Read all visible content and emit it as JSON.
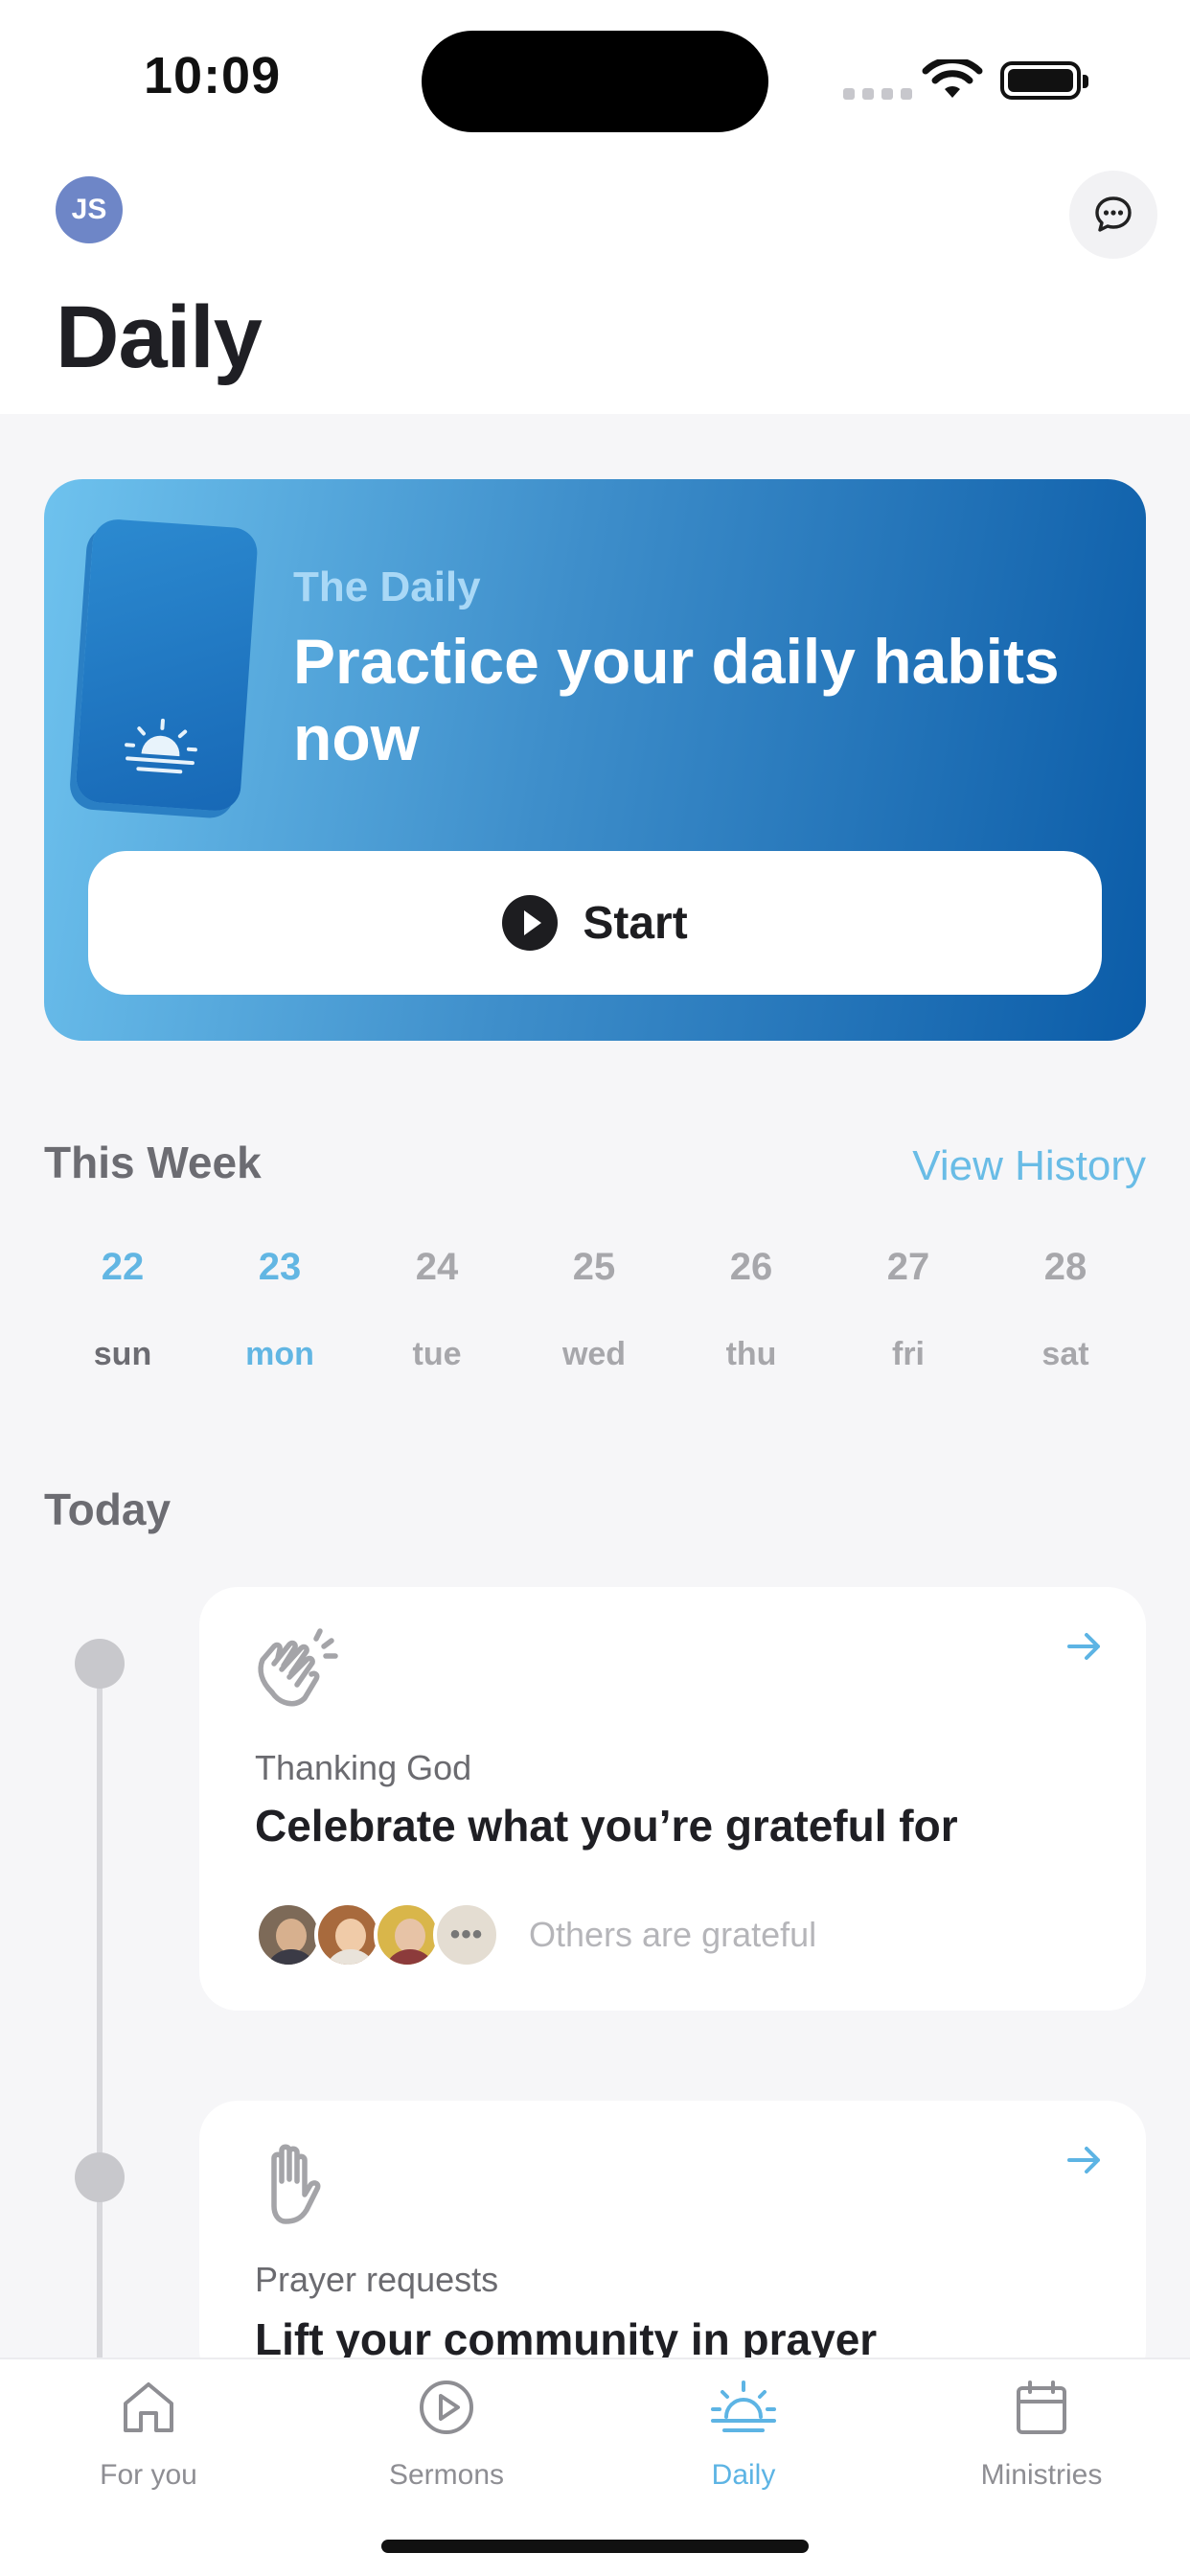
{
  "status_bar": {
    "time": "10:09"
  },
  "header": {
    "avatar_initials": "JS",
    "title": "Daily"
  },
  "hero": {
    "eyebrow": "The Daily",
    "title": "Practice your daily habits now",
    "start_label": "Start",
    "colors": {
      "gradient_start": "#6ec2ee",
      "gradient_end": "#0b5ca8"
    }
  },
  "week": {
    "title": "This Week",
    "view_history": "View History",
    "days": [
      {
        "num": "22",
        "name": "sun"
      },
      {
        "num": "23",
        "name": "mon"
      },
      {
        "num": "24",
        "name": "tue"
      },
      {
        "num": "25",
        "name": "wed"
      },
      {
        "num": "26",
        "name": "thu"
      },
      {
        "num": "27",
        "name": "fri"
      },
      {
        "num": "28",
        "name": "sat"
      }
    ]
  },
  "today": {
    "title": "Today",
    "tasks": [
      {
        "kicker": "Thanking God",
        "title": "Celebrate what you’re grateful for",
        "others_text": "Others are grateful",
        "icon": "clapping-hands-icon"
      },
      {
        "kicker": "Prayer requests",
        "title": "Lift your community in prayer",
        "icon": "raised-hand-icon"
      }
    ]
  },
  "tabbar": {
    "items": [
      {
        "label": "For you",
        "icon": "home-icon"
      },
      {
        "label": "Sermons",
        "icon": "play-circle-icon"
      },
      {
        "label": "Daily",
        "icon": "sunrise-icon"
      },
      {
        "label": "Ministries",
        "icon": "calendar-icon"
      }
    ],
    "active_color": "#5db4e4"
  },
  "accent_color": "#62b6e3"
}
